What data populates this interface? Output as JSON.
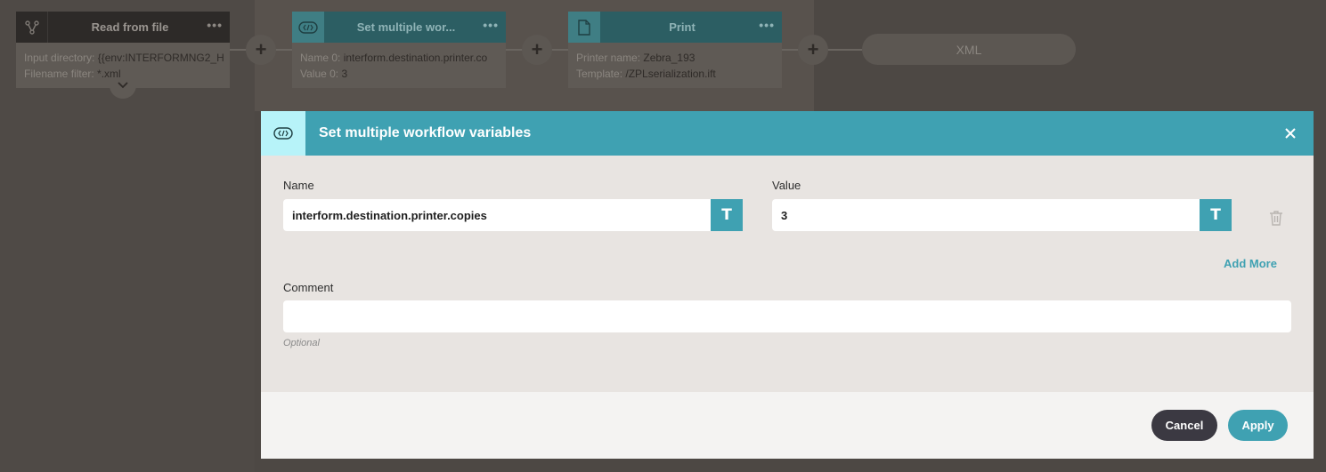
{
  "workflow": {
    "nodes": [
      {
        "title": "Read from file",
        "icon": "workflow-branch-icon",
        "menu": "•••",
        "lines": [
          {
            "key": "Input directory:",
            "value": "{{env:INTERFORMNG2_H"
          },
          {
            "key": "Filename filter:",
            "value": "*.xml"
          }
        ]
      },
      {
        "title": "Set multiple wor...",
        "icon": "variables-icon",
        "menu": "•••",
        "lines": [
          {
            "key": "Name 0:",
            "value": "interform.destination.printer.co"
          },
          {
            "key": "Value 0:",
            "value": "3"
          }
        ]
      },
      {
        "title": "Print",
        "icon": "document-icon",
        "menu": "•••",
        "lines": [
          {
            "key": "Printer name:",
            "value": "Zebra_193"
          },
          {
            "key": "Template:",
            "value": "/ZPLserialization.ift"
          }
        ]
      }
    ],
    "add_label": "+",
    "end_node": "XML"
  },
  "modal": {
    "title": "Set multiple workflow variables",
    "name_label": "Name",
    "name_value": "interform.destination.printer.copies",
    "value_label": "Value",
    "value_value": "3",
    "type_button": "T",
    "add_more": "Add More",
    "comment_label": "Comment",
    "comment_value": "",
    "optional_hint": "Optional",
    "cancel": "Cancel",
    "apply": "Apply"
  },
  "colors": {
    "accent": "#3fa1b2",
    "dark_button": "#3b3942",
    "icon_highlight": "#b7f3f9"
  }
}
